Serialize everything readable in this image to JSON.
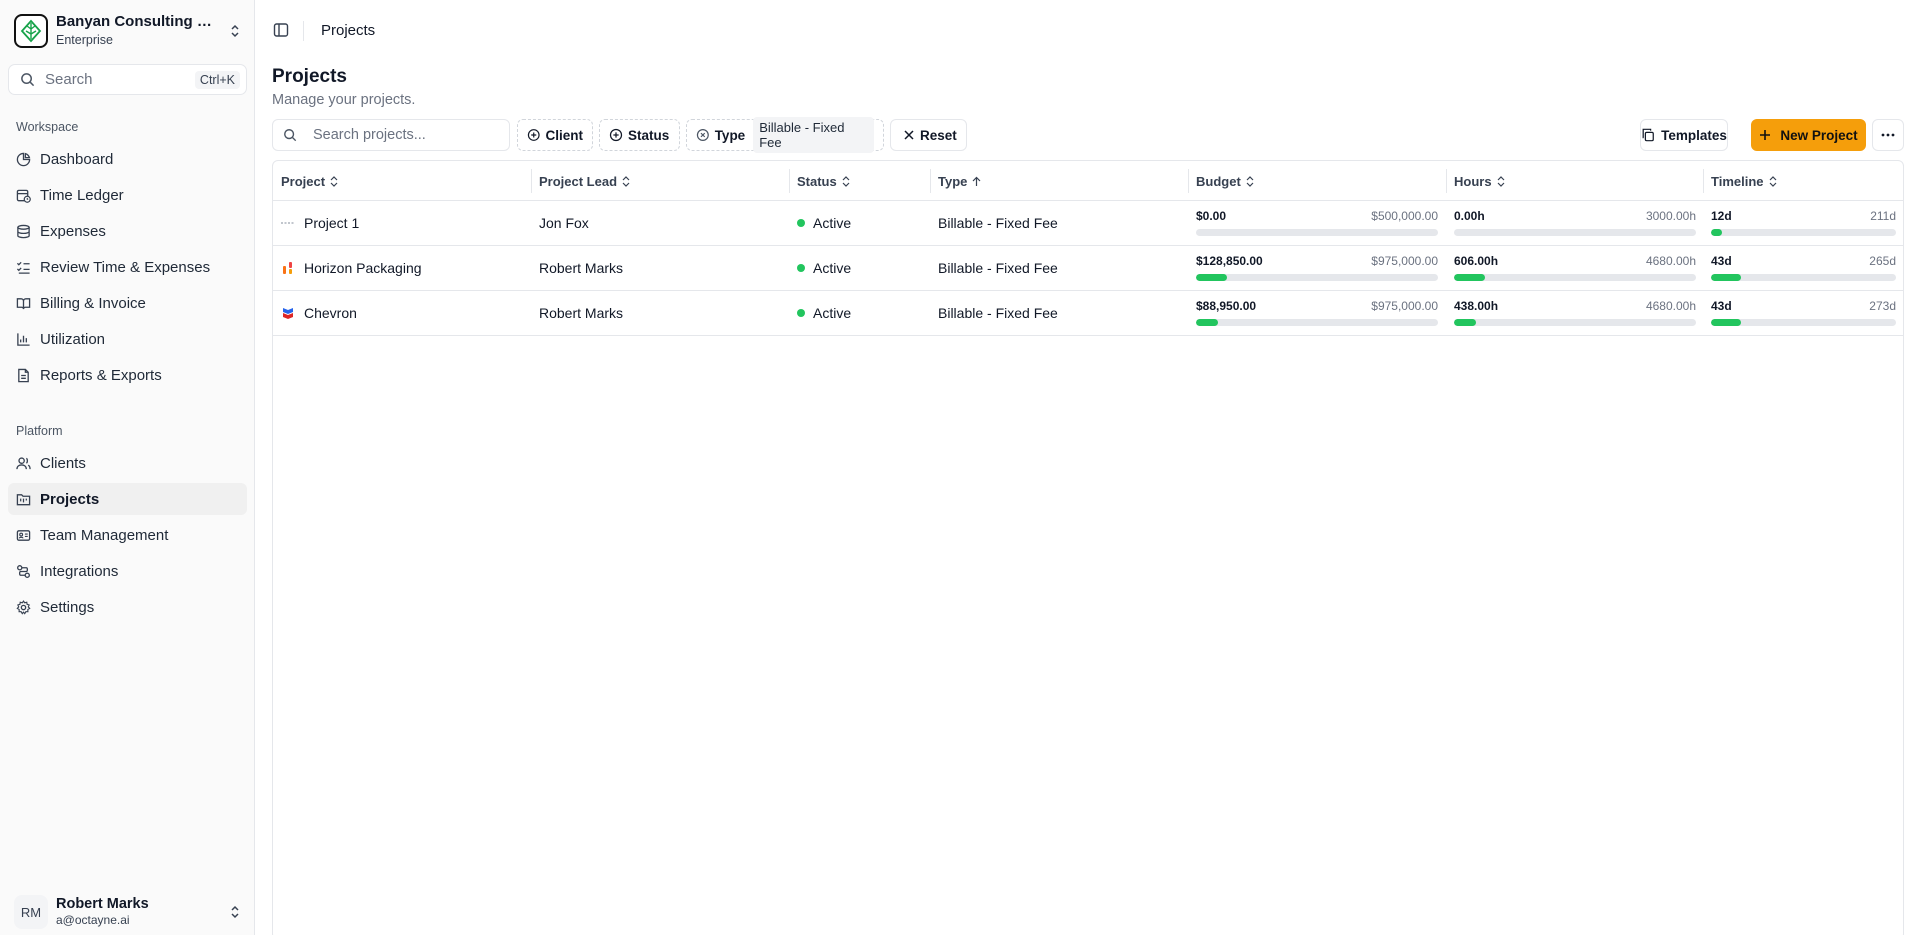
{
  "org": {
    "name": "Banyan Consulting Gr...",
    "plan": "Enterprise"
  },
  "sidebar_search": {
    "placeholder": "Search",
    "shortcut": "Ctrl+K"
  },
  "workspace": {
    "label": "Workspace",
    "items": [
      {
        "label": "Dashboard",
        "icon": "pie-chart-icon"
      },
      {
        "label": "Time Ledger",
        "icon": "calendar-clock-icon"
      },
      {
        "label": "Expenses",
        "icon": "database-icon"
      },
      {
        "label": "Review Time & Expenses",
        "icon": "list-checks-icon"
      },
      {
        "label": "Billing & Invoice",
        "icon": "book-open-icon"
      },
      {
        "label": "Utilization",
        "icon": "bar-chart-icon"
      },
      {
        "label": "Reports & Exports",
        "icon": "file-text-icon"
      }
    ]
  },
  "platform": {
    "label": "Platform",
    "items": [
      {
        "label": "Clients",
        "icon": "users-icon"
      },
      {
        "label": "Projects",
        "icon": "folder-kanban-icon",
        "active": true
      },
      {
        "label": "Team Management",
        "icon": "id-card-icon"
      },
      {
        "label": "Integrations",
        "icon": "workflow-icon"
      },
      {
        "label": "Settings",
        "icon": "gear-icon"
      }
    ]
  },
  "user": {
    "initials": "RM",
    "name": "Robert Marks",
    "email": "a@octayne.ai"
  },
  "breadcrumb": "Projects",
  "page": {
    "title": "Projects",
    "subtitle": "Manage your projects."
  },
  "toolbar": {
    "search_placeholder": "Search projects...",
    "client": "Client",
    "status": "Status",
    "type": "Type",
    "type_value": "Billable - Fixed Fee",
    "reset": "Reset",
    "templates": "Templates",
    "new_project": "New Project"
  },
  "table": {
    "columns": [
      "Project",
      "Project Lead",
      "Status",
      "Type",
      "Budget",
      "Hours",
      "Timeline"
    ],
    "rows": [
      {
        "project": "Project 1",
        "lead": "Jon Fox",
        "status": "Active",
        "type": "Billable - Fixed Fee",
        "budget": {
          "current": "$0.00",
          "max": "$500,000.00",
          "progress": 0
        },
        "hours": {
          "current": "0.00h",
          "max": "3000.00h",
          "progress": 0
        },
        "timeline": {
          "current": "12d",
          "max": "211d",
          "progress": 0.06
        }
      },
      {
        "project": "Horizon Packaging",
        "lead": "Robert Marks",
        "status": "Active",
        "type": "Billable - Fixed Fee",
        "budget": {
          "current": "$128,850.00",
          "max": "$975,000.00",
          "progress": 0.13
        },
        "hours": {
          "current": "606.00h",
          "max": "4680.00h",
          "progress": 0.13
        },
        "timeline": {
          "current": "43d",
          "max": "265d",
          "progress": 0.16
        }
      },
      {
        "project": "Chevron",
        "lead": "Robert Marks",
        "status": "Active",
        "type": "Billable - Fixed Fee",
        "budget": {
          "current": "$88,950.00",
          "max": "$975,000.00",
          "progress": 0.09
        },
        "hours": {
          "current": "438.00h",
          "max": "4680.00h",
          "progress": 0.09
        },
        "timeline": {
          "current": "43d",
          "max": "273d",
          "progress": 0.16
        }
      }
    ]
  },
  "colors": {
    "accent": "#f59e0b",
    "success": "#22c55e",
    "track": "#e5e7eb"
  }
}
